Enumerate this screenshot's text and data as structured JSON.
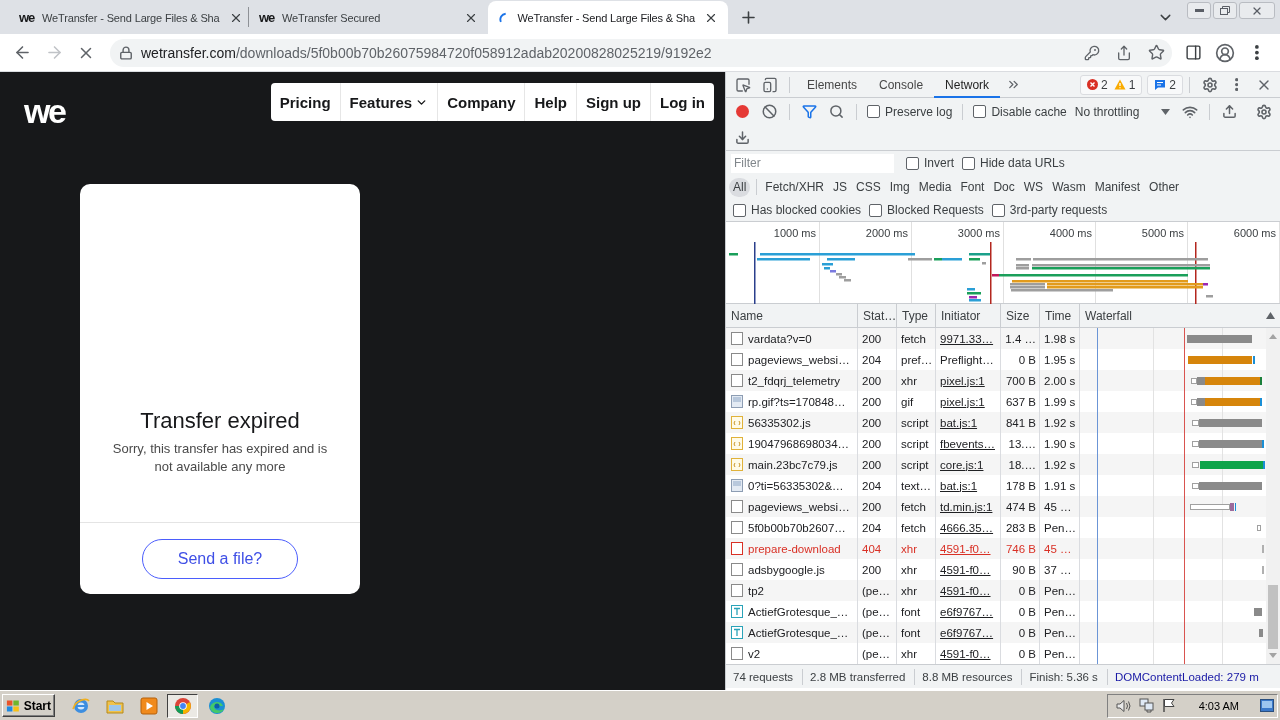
{
  "browser": {
    "tabs": [
      {
        "favicon": "we",
        "title": "WeTransfer - Send Large Files & Sha",
        "selected": false,
        "loading": false
      },
      {
        "favicon": "we",
        "title": "WeTransfer Secured",
        "selected": false,
        "loading": false
      },
      {
        "title": "WeTransfer - Send Large Files & Sha",
        "selected": true,
        "loading": true
      }
    ],
    "back": {
      "disabled": false
    },
    "forward": {
      "disabled": true
    },
    "address": {
      "host": "wetransfer.com",
      "path": "/downloads/5f0b00b70b26075984720f058912adab20200828025219/9192e2"
    }
  },
  "page": {
    "logo": "we",
    "nav": [
      {
        "label": "Pricing",
        "dropdown": false
      },
      {
        "label": "Features",
        "dropdown": true
      },
      {
        "label": "Company",
        "dropdown": false
      },
      {
        "label": "Help",
        "dropdown": false
      },
      {
        "label": "Sign up",
        "dropdown": false
      },
      {
        "label": "Log in",
        "dropdown": false
      }
    ],
    "card": {
      "title": "Transfer expired",
      "message": "Sorry, this transfer has expired and is not available any more",
      "button": "Send a file?"
    }
  },
  "devtools": {
    "tabs": [
      {
        "label": "Elements",
        "selected": false
      },
      {
        "label": "Console",
        "selected": false
      },
      {
        "label": "Network",
        "selected": true
      }
    ],
    "issues": {
      "errors": "2",
      "warnings": "1",
      "messages": "2"
    },
    "toolbar": {
      "recording": true,
      "filter_open": true,
      "preserve_log": {
        "label": "Preserve log",
        "checked": false
      },
      "disable_cache": {
        "label": "Disable cache",
        "checked": false
      },
      "throttling": "No throttling"
    },
    "filter": {
      "placeholder": "Filter",
      "invert": {
        "label": "Invert",
        "checked": false
      },
      "hide_data_urls": {
        "label": "Hide data URLs",
        "checked": false
      }
    },
    "type_filters": [
      {
        "label": "All",
        "selected": true
      },
      {
        "label": "Fetch/XHR",
        "selected": false
      },
      {
        "label": "JS",
        "selected": false
      },
      {
        "label": "CSS",
        "selected": false
      },
      {
        "label": "Img",
        "selected": false
      },
      {
        "label": "Media",
        "selected": false
      },
      {
        "label": "Font",
        "selected": false
      },
      {
        "label": "Doc",
        "selected": false
      },
      {
        "label": "WS",
        "selected": false
      },
      {
        "label": "Wasm",
        "selected": false
      },
      {
        "label": "Manifest",
        "selected": false
      },
      {
        "label": "Other",
        "selected": false
      }
    ],
    "request_filters": [
      {
        "label": "Has blocked cookies",
        "checked": false
      },
      {
        "label": "Blocked Requests",
        "checked": false
      },
      {
        "label": "3rd-party requests",
        "checked": false
      }
    ],
    "overview": {
      "ticks": [
        "1000 ms",
        "2000 ms",
        "3000 ms",
        "4000 ms",
        "5000 ms",
        "6000 ms"
      ]
    },
    "table": {
      "columns": [
        "Name",
        "Stat…",
        "Type",
        "Initiator",
        "Size",
        "Time",
        "Waterfall"
      ],
      "rows": [
        {
          "name": "vardata?v=0",
          "status": "200",
          "type": "fetch",
          "initiator": "9971.33…",
          "initiator_link": true,
          "size": "1.4 …",
          "time": "1.98 s",
          "kind": "document",
          "error": false
        },
        {
          "name": "pageviews_websi…",
          "status": "204",
          "type": "pref…",
          "initiator": "Preflight…",
          "initiator_link": false,
          "size": "0 B",
          "time": "1.95 s",
          "kind": "document",
          "error": false
        },
        {
          "name": "t2_fdqrj_telemetry",
          "status": "200",
          "type": "xhr",
          "initiator": "pixel.js:1",
          "initiator_link": true,
          "size": "700 B",
          "time": "2.00 s",
          "kind": "document",
          "error": false
        },
        {
          "name": "rp.gif?ts=170848…",
          "status": "200",
          "type": "gif",
          "initiator": "pixel.js:1",
          "initiator_link": true,
          "size": "637 B",
          "time": "1.99 s",
          "kind": "image",
          "error": false
        },
        {
          "name": "56335302.js",
          "status": "200",
          "type": "script",
          "initiator": "bat.js:1",
          "initiator_link": true,
          "size": "841 B",
          "time": "1.92 s",
          "kind": "script",
          "error": false
        },
        {
          "name": "19047968698034…",
          "status": "200",
          "type": "script",
          "initiator": "fbevents…",
          "initiator_link": true,
          "size": "13.…",
          "time": "1.90 s",
          "kind": "script",
          "error": false
        },
        {
          "name": "main.23bc7c79.js",
          "status": "200",
          "type": "script",
          "initiator": "core.js:1",
          "initiator_link": true,
          "size": "18.…",
          "time": "1.92 s",
          "kind": "script",
          "error": false
        },
        {
          "name": "0?ti=56335302&…",
          "status": "204",
          "type": "text…",
          "initiator": "bat.js:1",
          "initiator_link": true,
          "size": "178 B",
          "time": "1.91 s",
          "kind": "image",
          "error": false
        },
        {
          "name": "pageviews_websi…",
          "status": "200",
          "type": "fetch",
          "initiator": "td.min.js:1",
          "initiator_link": true,
          "size": "474 B",
          "time": "45 …",
          "kind": "document",
          "error": false
        },
        {
          "name": "5f0b00b70b2607…",
          "status": "204",
          "type": "fetch",
          "initiator": "4666.35…",
          "initiator_link": true,
          "size": "283 B",
          "time": "Pen…",
          "kind": "document",
          "error": false
        },
        {
          "name": "prepare-download",
          "status": "404",
          "type": "xhr",
          "initiator": "4591-f0…",
          "initiator_link": true,
          "size": "746 B",
          "time": "45 …",
          "kind": "document",
          "error": true
        },
        {
          "name": "adsbygoogle.js",
          "status": "200",
          "type": "xhr",
          "initiator": "4591-f0…",
          "initiator_link": true,
          "size": "90 B",
          "time": "37 …",
          "kind": "document",
          "error": false
        },
        {
          "name": "tp2",
          "status": "(pe…",
          "type": "xhr",
          "initiator": "4591-f0…",
          "initiator_link": true,
          "size": "0 B",
          "time": "Pen…",
          "kind": "document",
          "error": false
        },
        {
          "name": "ActiefGrotesque_…",
          "status": "(pe…",
          "type": "font",
          "initiator": "e6f9767…",
          "initiator_link": true,
          "size": "0 B",
          "time": "Pen…",
          "kind": "font",
          "error": false
        },
        {
          "name": "ActiefGrotesque_…",
          "status": "(pe…",
          "type": "font",
          "initiator": "e6f9767…",
          "initiator_link": true,
          "size": "0 B",
          "time": "Pen…",
          "kind": "font",
          "error": false
        },
        {
          "name": "v2",
          "status": "(pe…",
          "type": "xhr",
          "initiator": "4591-f0…",
          "initiator_link": true,
          "size": "0 B",
          "time": "Pen…",
          "kind": "document",
          "error": false
        }
      ]
    },
    "status_bar": [
      {
        "text": "74 requests",
        "kind": "plain"
      },
      {
        "text": "2.8 MB transferred",
        "kind": "plain"
      },
      {
        "text": "8.8 MB resources",
        "kind": "plain"
      },
      {
        "text": "Finish: 5.36 s",
        "kind": "plain"
      },
      {
        "text": "DOMContentLoaded: 279 m",
        "kind": "dom"
      }
    ]
  },
  "taskbar": {
    "start": "Start",
    "apps": [
      {
        "kind": "ie",
        "selected": false
      },
      {
        "kind": "folder",
        "selected": false
      },
      {
        "kind": "media",
        "selected": false
      },
      {
        "kind": "chrome",
        "selected": true
      },
      {
        "kind": "edge",
        "selected": false
      }
    ],
    "clock": "4:03 AM"
  }
}
